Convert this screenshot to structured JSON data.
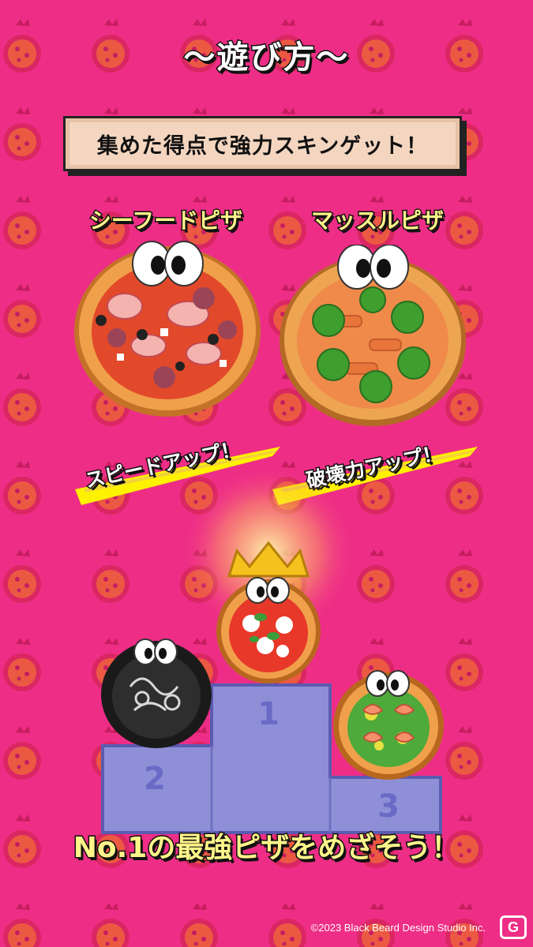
{
  "header": {
    "title": "〜遊び方〜"
  },
  "banner": {
    "text": "集めた得点で強力スキンゲット！"
  },
  "skins": [
    {
      "name": "シーフードピザ",
      "effect": "スピードアップ！",
      "icon": "seafood-pizza-icon"
    },
    {
      "name": "マッスルピザ",
      "effect": "破壊力アップ！",
      "icon": "broccoli-pizza-icon"
    }
  ],
  "podium": {
    "ranks": [
      "1",
      "2",
      "3"
    ],
    "first": "margherita-pizza-with-crown",
    "second": "squid-ink-pizza",
    "third": "shrimp-pizza"
  },
  "footer": {
    "tagline": "No.1の最強ピザをめざそう！",
    "copyright": "©2023 Black Beard Design Studio Inc."
  },
  "watermark": {
    "text": "G"
  },
  "colors": {
    "background": "#ee2e86",
    "podium": "#8f8fd8",
    "highlight": "#fff58a"
  }
}
